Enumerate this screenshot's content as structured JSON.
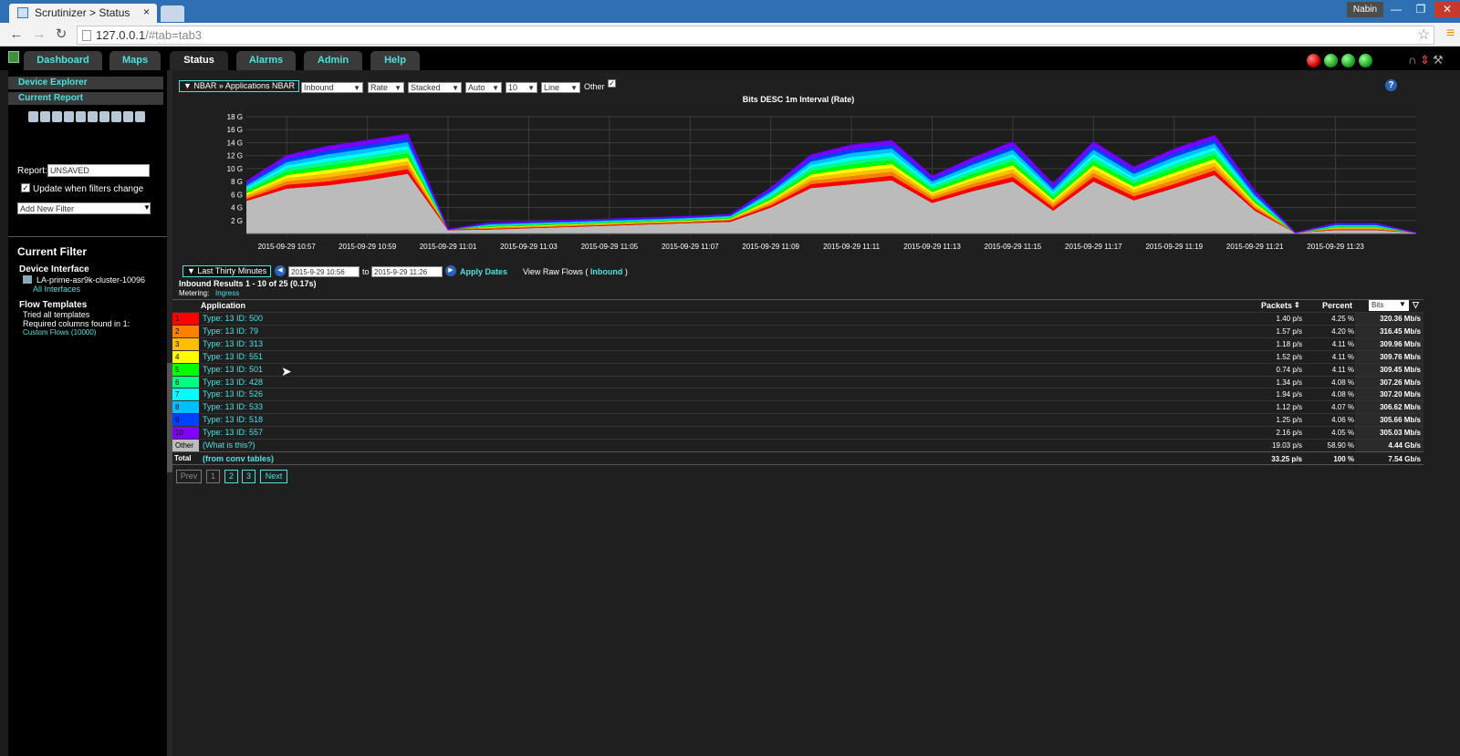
{
  "browser": {
    "tab_title": "Scrutinizer > Status",
    "tab_close": "×",
    "user": "Nabin",
    "url_host": "127.0.0.1",
    "url_path": "/#tab=tab3",
    "min": "—",
    "max": "❐",
    "close": "✕"
  },
  "topnav": {
    "tabs": [
      "Dashboard",
      "Maps",
      "Status",
      "Alarms",
      "Admin",
      "Help"
    ],
    "active": "Status"
  },
  "status_indicators": [
    "#d40000",
    "#22a822",
    "#22a822",
    "#22a822"
  ],
  "sidebar": {
    "device_explorer": "Device Explorer",
    "current_report": "Current Report",
    "report_label": "Report:",
    "report_value": "UNSAVED",
    "update_label": "Update when filters change",
    "add_filter": "Add New Filter",
    "current_filter_title": "Current Filter",
    "device_interface_label": "Device Interface",
    "device_name": "LA-prime-asr9k-cluster-10096",
    "all_interfaces": "All Interfaces",
    "flow_templates_label": "Flow Templates",
    "flow_templates_line1": "Tried all templates",
    "flow_templates_line2": "Required columns found in 1:",
    "flow_templates_link": "Custom Flows (10000)"
  },
  "report": {
    "breadcrumb": "▼ NBAR » Applications NBAR",
    "selectors": [
      "Inbound",
      "Rate",
      "Stacked",
      "Auto",
      "10",
      "Line"
    ],
    "other_label": "Other",
    "chart_title": "Bits DESC 1m Interval (Rate)",
    "time_range": "▼ Last Thirty Minutes",
    "from": "2015-9-29 10:56",
    "to_label": "to",
    "to": "2015-9-29 11:26",
    "apply": "Apply Dates",
    "raw_flows": "View Raw Flows (",
    "raw_flows_link": "Inbound",
    "raw_flows_end": ")",
    "results": "Inbound Results 1 - 10 of 25 (0.17s)",
    "metering_label": "Metering:",
    "metering_value": "Ingress"
  },
  "table": {
    "headers": {
      "application": "Application",
      "packets": "Packets",
      "percent": "Percent",
      "bits": "Bits"
    },
    "rows": [
      {
        "rank": "1",
        "app": "Type: 13 ID: 500",
        "packets": "1.40 p/s",
        "percent": "4.25 %",
        "bits": "320.36 Mb/s",
        "color": "#ff0000"
      },
      {
        "rank": "2",
        "app": "Type: 13 ID: 79",
        "packets": "1.57 p/s",
        "percent": "4.20 %",
        "bits": "316.45 Mb/s",
        "color": "#ff7f00"
      },
      {
        "rank": "3",
        "app": "Type: 13 ID: 313",
        "packets": "1.18 p/s",
        "percent": "4.11 %",
        "bits": "309.96 Mb/s",
        "color": "#ffbf00"
      },
      {
        "rank": "4",
        "app": "Type: 13 ID: 551",
        "packets": "1.52 p/s",
        "percent": "4.11 %",
        "bits": "309.76 Mb/s",
        "color": "#ffff00"
      },
      {
        "rank": "5",
        "app": "Type: 13 ID: 501",
        "packets": "0.74 p/s",
        "percent": "4.11 %",
        "bits": "309.45 Mb/s",
        "color": "#00ff00"
      },
      {
        "rank": "6",
        "app": "Type: 13 ID: 428",
        "packets": "1.34 p/s",
        "percent": "4.08 %",
        "bits": "307.26 Mb/s",
        "color": "#00ff7f"
      },
      {
        "rank": "7",
        "app": "Type: 13 ID: 526",
        "packets": "1.94 p/s",
        "percent": "4.08 %",
        "bits": "307.20 Mb/s",
        "color": "#00ffff"
      },
      {
        "rank": "8",
        "app": "Type: 13 ID: 533",
        "packets": "1.12 p/s",
        "percent": "4.07 %",
        "bits": "306.62 Mb/s",
        "color": "#00bfff"
      },
      {
        "rank": "9",
        "app": "Type: 13 ID: 518",
        "packets": "1.25 p/s",
        "percent": "4.06 %",
        "bits": "305.66 Mb/s",
        "color": "#0040ff"
      },
      {
        "rank": "10",
        "app": "Type: 13 ID: 557",
        "packets": "2.16 p/s",
        "percent": "4.05 %",
        "bits": "305.03 Mb/s",
        "color": "#7f00ff"
      },
      {
        "rank": "Other",
        "app": "(What is this?)",
        "packets": "19.03 p/s",
        "percent": "58.90 %",
        "bits": "4.44 Gb/s",
        "color": "#bbbbbb"
      }
    ],
    "total": {
      "label": "Total",
      "app": "(from conv tables)",
      "packets": "33.25 p/s",
      "percent": "100 %",
      "bits": "7.54 Gb/s"
    }
  },
  "pagination": {
    "prev": "Prev",
    "pages": [
      "1",
      "2",
      "3"
    ],
    "next": "Next"
  },
  "chart_data": {
    "type": "area",
    "title": "Bits DESC 1m Interval (Rate)",
    "stacked": true,
    "x": [
      "2015-09-29 10:56",
      "2015-09-29 10:57",
      "2015-09-29 10:58",
      "2015-09-29 10:59",
      "2015-09-29 11:00",
      "2015-09-29 11:01",
      "2015-09-29 11:02",
      "2015-09-29 11:03",
      "2015-09-29 11:04",
      "2015-09-29 11:05",
      "2015-09-29 11:06",
      "2015-09-29 11:07",
      "2015-09-29 11:08",
      "2015-09-29 11:09",
      "2015-09-29 11:10",
      "2015-09-29 11:11",
      "2015-09-29 11:12",
      "2015-09-29 11:13",
      "2015-09-29 11:14",
      "2015-09-29 11:15",
      "2015-09-29 11:16",
      "2015-09-29 11:17",
      "2015-09-29 11:18",
      "2015-09-29 11:19",
      "2015-09-29 11:20",
      "2015-09-29 11:21",
      "2015-09-29 11:22",
      "2015-09-29 11:23",
      "2015-09-29 11:24",
      "2015-09-29 11:25"
    ],
    "x_tick_labels": [
      "2015-09-29 10:57",
      "2015-09-29 10:59",
      "2015-09-29 11:01",
      "2015-09-29 11:03",
      "2015-09-29 11:05",
      "2015-09-29 11:07",
      "2015-09-29 11:09",
      "2015-09-29 11:11",
      "2015-09-29 11:13",
      "2015-09-29 11:15",
      "2015-09-29 11:17",
      "2015-09-29 11:19",
      "2015-09-29 11:21",
      "2015-09-29 11:23"
    ],
    "y_tick_labels": [
      "2 G",
      "4 G",
      "6 G",
      "8 G",
      "10 G",
      "12 G",
      "14 G",
      "16 G",
      "18 G"
    ],
    "ylim": [
      0,
      18
    ],
    "y_unit": "G",
    "grid": true,
    "series_order_bottom_to_top": [
      "Other",
      "1",
      "2",
      "3",
      "4",
      "5",
      "6",
      "7",
      "8",
      "9",
      "10"
    ],
    "series": [
      {
        "name": "Other",
        "color": "#bbbbbb",
        "values": [
          5.0,
          6.9,
          7.4,
          8.2,
          9.2,
          0.5,
          0.6,
          0.8,
          1.0,
          1.2,
          1.4,
          1.6,
          1.8,
          4.0,
          7.0,
          7.6,
          8.2,
          4.7,
          6.5,
          8.0,
          3.5,
          8.0,
          5.1,
          7.0,
          9.0,
          3.5,
          0.1,
          0.5,
          0.5,
          0.1
        ]
      },
      {
        "name": "1",
        "color": "#ff0000",
        "values": [
          0.3,
          0.6,
          0.6,
          0.7,
          0.7,
          0.1,
          0.1,
          0.1,
          0.1,
          0.1,
          0.1,
          0.1,
          0.2,
          0.3,
          0.6,
          0.6,
          0.7,
          0.5,
          0.6,
          0.7,
          0.5,
          0.7,
          0.6,
          0.6,
          0.7,
          0.3,
          0.0,
          0.1,
          0.1,
          0.0
        ]
      },
      {
        "name": "2",
        "color": "#ff7f00",
        "values": [
          0.3,
          0.5,
          0.6,
          0.6,
          0.6,
          0.0,
          0.1,
          0.1,
          0.1,
          0.1,
          0.1,
          0.1,
          0.1,
          0.3,
          0.5,
          0.6,
          0.6,
          0.4,
          0.5,
          0.6,
          0.4,
          0.6,
          0.5,
          0.6,
          0.6,
          0.3,
          0.0,
          0.1,
          0.1,
          0.0
        ]
      },
      {
        "name": "3",
        "color": "#ffbf00",
        "values": [
          0.3,
          0.5,
          0.6,
          0.6,
          0.6,
          0.0,
          0.1,
          0.1,
          0.1,
          0.1,
          0.1,
          0.1,
          0.1,
          0.3,
          0.5,
          0.6,
          0.6,
          0.4,
          0.5,
          0.6,
          0.4,
          0.6,
          0.5,
          0.6,
          0.6,
          0.3,
          0.0,
          0.1,
          0.1,
          0.0
        ]
      },
      {
        "name": "4",
        "color": "#ffff00",
        "values": [
          0.3,
          0.5,
          0.6,
          0.6,
          0.6,
          0.0,
          0.1,
          0.1,
          0.1,
          0.1,
          0.1,
          0.1,
          0.1,
          0.3,
          0.5,
          0.6,
          0.6,
          0.4,
          0.5,
          0.6,
          0.4,
          0.6,
          0.5,
          0.6,
          0.6,
          0.3,
          0.0,
          0.1,
          0.1,
          0.0
        ]
      },
      {
        "name": "5",
        "color": "#00ff00",
        "values": [
          0.3,
          0.5,
          0.6,
          0.6,
          0.6,
          0.0,
          0.1,
          0.1,
          0.1,
          0.1,
          0.1,
          0.1,
          0.1,
          0.3,
          0.5,
          0.6,
          0.6,
          0.4,
          0.5,
          0.6,
          0.4,
          0.6,
          0.5,
          0.6,
          0.6,
          0.3,
          0.0,
          0.1,
          0.1,
          0.0
        ]
      },
      {
        "name": "6",
        "color": "#00ff7f",
        "values": [
          0.3,
          0.5,
          0.6,
          0.6,
          0.6,
          0.0,
          0.1,
          0.1,
          0.1,
          0.1,
          0.1,
          0.1,
          0.1,
          0.3,
          0.5,
          0.6,
          0.6,
          0.4,
          0.5,
          0.6,
          0.4,
          0.6,
          0.5,
          0.6,
          0.6,
          0.3,
          0.0,
          0.1,
          0.1,
          0.0
        ]
      },
      {
        "name": "7",
        "color": "#00ffff",
        "values": [
          0.3,
          0.5,
          0.6,
          0.6,
          0.6,
          0.0,
          0.1,
          0.1,
          0.1,
          0.1,
          0.1,
          0.1,
          0.1,
          0.3,
          0.5,
          0.6,
          0.6,
          0.4,
          0.5,
          0.6,
          0.4,
          0.6,
          0.5,
          0.6,
          0.6,
          0.3,
          0.0,
          0.1,
          0.1,
          0.0
        ]
      },
      {
        "name": "8",
        "color": "#00bfff",
        "values": [
          0.3,
          0.5,
          0.6,
          0.6,
          0.6,
          0.0,
          0.1,
          0.1,
          0.1,
          0.1,
          0.1,
          0.1,
          0.1,
          0.3,
          0.5,
          0.6,
          0.6,
          0.4,
          0.5,
          0.6,
          0.4,
          0.6,
          0.5,
          0.6,
          0.6,
          0.3,
          0.0,
          0.1,
          0.1,
          0.0
        ]
      },
      {
        "name": "9",
        "color": "#0040ff",
        "values": [
          0.3,
          0.5,
          0.6,
          0.6,
          0.6,
          0.0,
          0.1,
          0.1,
          0.1,
          0.1,
          0.1,
          0.1,
          0.1,
          0.3,
          0.5,
          0.6,
          0.6,
          0.4,
          0.5,
          0.6,
          0.4,
          0.6,
          0.5,
          0.6,
          0.6,
          0.3,
          0.0,
          0.1,
          0.1,
          0.0
        ]
      },
      {
        "name": "10",
        "color": "#7f00ff",
        "values": [
          0.3,
          0.5,
          0.6,
          0.6,
          0.6,
          0.0,
          0.1,
          0.1,
          0.1,
          0.1,
          0.1,
          0.1,
          0.1,
          0.3,
          0.5,
          0.6,
          0.6,
          0.4,
          0.5,
          0.6,
          0.4,
          0.6,
          0.5,
          0.6,
          0.6,
          0.3,
          0.0,
          0.1,
          0.1,
          0.0
        ]
      }
    ]
  }
}
